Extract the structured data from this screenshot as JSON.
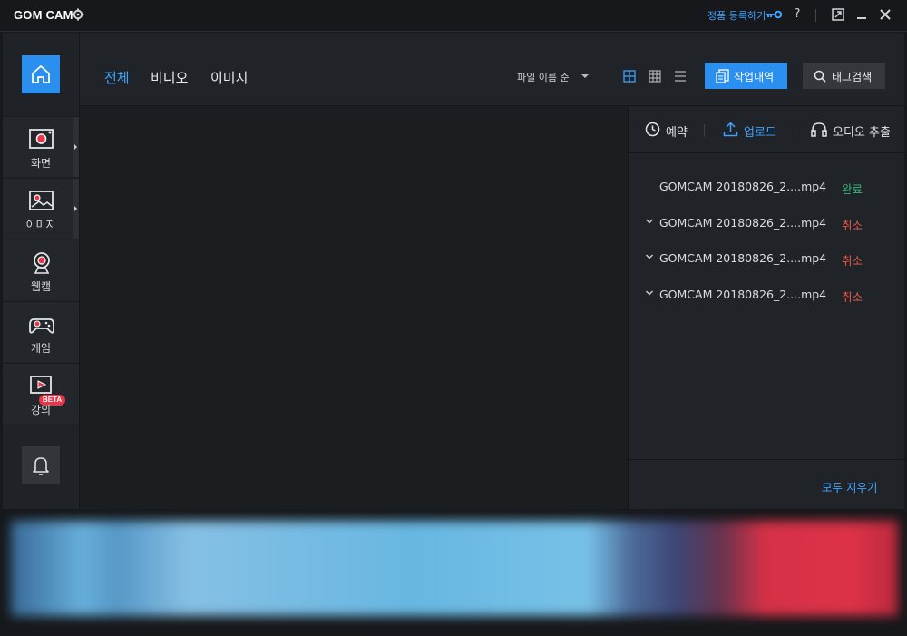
{
  "titlebar": {
    "app_name": "GOM CAM",
    "register_label": "정품 등록하기",
    "help_label": "?"
  },
  "sidebar": {
    "items": [
      {
        "label": "화면",
        "icon": "screen-record-icon"
      },
      {
        "label": "이미지",
        "icon": "image-icon"
      },
      {
        "label": "웹캠",
        "icon": "webcam-icon"
      },
      {
        "label": "게임",
        "icon": "gamepad-icon"
      },
      {
        "label": "강의",
        "icon": "lecture-icon",
        "badge": "BETA"
      }
    ]
  },
  "header": {
    "tabs": [
      {
        "label": "전체",
        "active": true
      },
      {
        "label": "비디오",
        "active": false
      },
      {
        "label": "이미지",
        "active": false
      }
    ],
    "sort_label": "파일 이름 순",
    "work_history_label": "작업내역",
    "tag_search_label": "태그검색"
  },
  "right_panel": {
    "tabs": [
      {
        "label": "예약",
        "icon": "clock-icon"
      },
      {
        "label": "업로드",
        "icon": "upload-icon"
      },
      {
        "label": "오디오 추출",
        "icon": "headphones-icon"
      }
    ],
    "active_tab": "업로드",
    "rows": [
      {
        "file": "GOMCAM 20180826_2....mp4",
        "status": "완료",
        "expandable": false
      },
      {
        "file": "GOMCAM 20180826_2....mp4",
        "status": "취소",
        "expandable": true
      },
      {
        "file": "GOMCAM 20180826_2....mp4",
        "status": "취소",
        "expandable": true
      },
      {
        "file": "GOMCAM 20180826_2....mp4",
        "status": "취소",
        "expandable": true
      }
    ],
    "clear_all_label": "모두 지우기"
  },
  "colors": {
    "accent": "#2b8ff0",
    "link": "#3ea2ff",
    "status_done": "#35b87a",
    "status_cancel": "#ee5b4c",
    "beta_badge": "#e8364a"
  }
}
